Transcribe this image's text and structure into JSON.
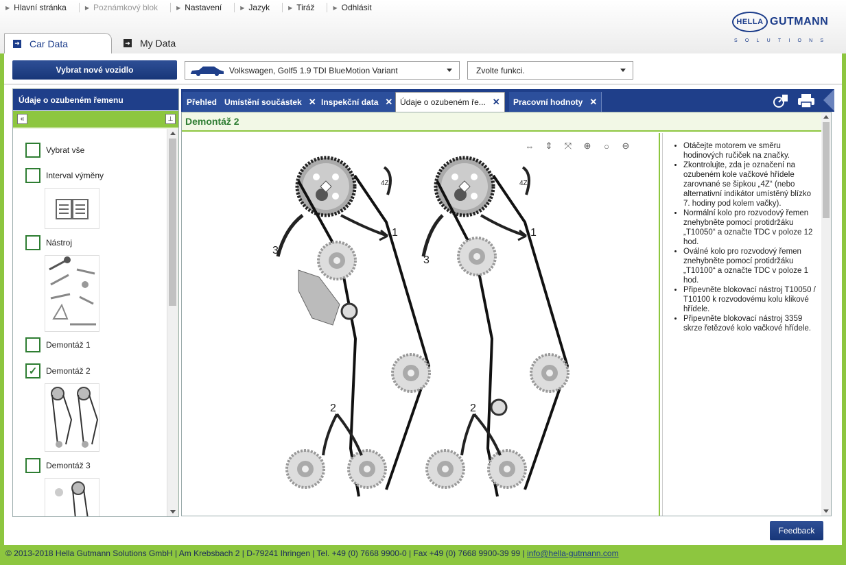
{
  "topnav": {
    "links": [
      {
        "label": "Hlavní stránka",
        "enabled": true
      },
      {
        "label": "Poznámkový blok",
        "enabled": false
      },
      {
        "label": "Nastavení",
        "enabled": true
      },
      {
        "label": "Jazyk",
        "enabled": true
      },
      {
        "label": "Tiráž",
        "enabled": true
      },
      {
        "label": "Odhlásit",
        "enabled": true
      }
    ]
  },
  "logo": {
    "hella": "HELLA",
    "gutmann": "GUTMANN",
    "solutions": "SOLUTIONS"
  },
  "main_tabs": {
    "car_data": "Car Data",
    "my_data": "My Data"
  },
  "toolbar": {
    "new_vehicle": "Vybrat nové vozidlo",
    "vehicle": "Volkswagen, Golf5 1.9 TDI BlueMotion Variant",
    "function": "Zvolte funkci."
  },
  "left_panel": {
    "title": "Údaje o ozubeném řemenu",
    "items": [
      {
        "label": "Vybrat vše",
        "checked": false
      },
      {
        "label": "Interval výměny",
        "checked": false
      },
      {
        "label": "Nástroj",
        "checked": false
      },
      {
        "label": "Demontáž 1",
        "checked": false
      },
      {
        "label": "Demontáž 2",
        "checked": true
      },
      {
        "label": "Demontáž 3",
        "checked": false
      }
    ]
  },
  "doc_tabs": [
    {
      "label": "Přehled",
      "closable": false,
      "active": false
    },
    {
      "label": "Umístění součástek",
      "closable": true,
      "active": false
    },
    {
      "label": "Inspekční data",
      "closable": true,
      "active": false
    },
    {
      "label": "Údaje o ozubeném ře...",
      "closable": true,
      "active": true
    },
    {
      "label": "Pracovní hodnoty",
      "closable": true,
      "active": false
    }
  ],
  "content": {
    "title": "Demontáž 2",
    "diagram_labels": {
      "one": "1",
      "two": "2",
      "three": "3",
      "marker": "4Z"
    },
    "instructions": [
      "Otáčejte motorem ve směru hodinových ručiček na značky.",
      "Zkontrolujte, zda je označení na ozubeném kole vačkové hřídele zarovnané se šipkou „4Z“ (nebo alternativní indikátor umístěný blízko 7. hodiny pod kolem vačky).",
      "Normální kolo pro rozvodový řemen znehybněte pomocí protidržáku „T10050“ a označte TDC v poloze 12 hod.",
      "Oválné kolo pro rozvodový řemen znehybněte pomocí protidržáku „T10100“ a označte TDC v poloze 1 hod.",
      "Připevněte blokovací nástroj T10050 / T10100 k rozvodovému kolu klikové hřídele.",
      "Připevněte blokovací nástroj 3359 skrze řetězové kolo vačkové hřídele."
    ]
  },
  "feedback": "Feedback",
  "footer": {
    "text": "© 2013-2018 Hella Gutmann Solutions GmbH | Am Krebsbach 2 | D-79241 Ihringen | Tel. +49 (0) 7668 9900-0 | Fax +49 (0) 7668 9900-39 99 | ",
    "email": "info@hella-gutmann.com"
  },
  "colors": {
    "brand_blue": "#1f3f8a",
    "accent_green": "#8dc63f",
    "check_green": "#2e7d32"
  }
}
